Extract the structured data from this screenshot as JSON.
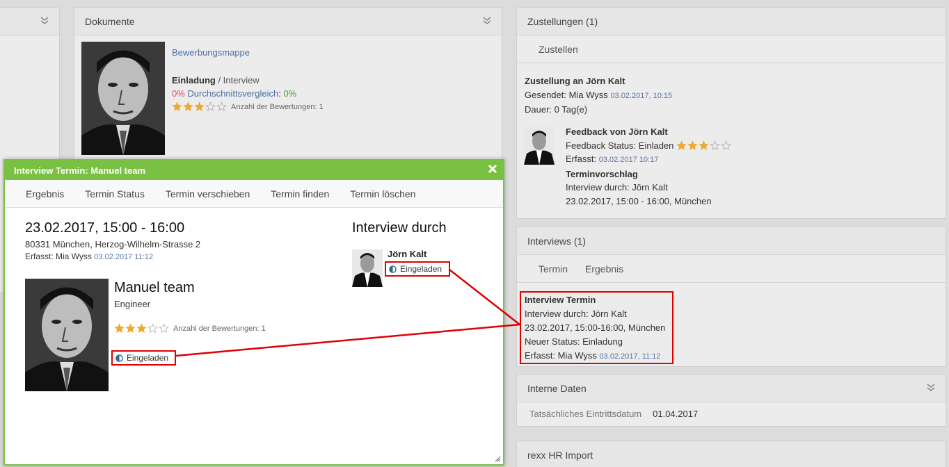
{
  "left_panel": {
    "chevron": "chevron-down-double-icon"
  },
  "documents": {
    "title": "Dokumente",
    "link": "Bewerbungsmappe",
    "invitation_bold": "Einladung",
    "invitation_rest": " / Interview",
    "percent": "0%",
    "avg_label": "Durchschnittsvergleich",
    "avg_value": "0%",
    "rating_label": "Anzahl der Bewertungen: 1",
    "rating": 3
  },
  "deliveries": {
    "title": "Zustellungen (1)",
    "tab": "Zustellen",
    "delivery_title": "Zustellung an Jörn Kalt",
    "sent_label": "Gesendet: Mia Wyss",
    "sent_date": "03.02.2017, 10:15",
    "duration": "Dauer: 0 Tag(e)",
    "feedback_title": "Feedback von Jörn Kalt",
    "feedback_status": "Feedback Status: Einladen",
    "feedback_rating": 3,
    "captured_label": "Erfasst:",
    "captured_date": "03.02.2017 10:17",
    "proposal_title": "Terminvorschlag",
    "proposal_by": "Interview durch: Jörn Kalt",
    "proposal_when": "23.02.2017, 15:00 - 16:00, München"
  },
  "interviews": {
    "title": "Interviews (1)",
    "tabs": [
      "Termin",
      "Ergebnis"
    ],
    "box_title": "Interview Termin",
    "by": "Interview durch: Jörn Kalt",
    "when": "23.02.2017, 15:00-16:00, München",
    "new_status": "Neuer Status: Einladung",
    "captured_label": "Erfasst: Mia Wyss",
    "captured_date": "03.02.2017, 11:12"
  },
  "internal": {
    "title": "Interne Daten",
    "field_label": "Tatsächliches Eintrittsdatum",
    "field_value": "01.04.2017"
  },
  "rexx": {
    "title": "rexx HR Import"
  },
  "modal": {
    "title": "Interview Termin: Manuel team",
    "tabs": [
      "Ergebnis",
      "Termin Status",
      "Termin verschieben",
      "Termin finden",
      "Termin löschen"
    ],
    "datetime": "23.02.2017, 15:00 - 16:00",
    "address": "80331 München, Herzog-Wilhelm-Strasse 2",
    "captured_label": "Erfasst: Mia Wyss",
    "captured_date": "03.02.2017 11:12",
    "candidate_name": "Manuel team",
    "candidate_role": "Engineer",
    "rating": 3,
    "rating_label": "Anzahl der Bewertungen: 1",
    "candidate_status": "Eingeladen",
    "interviewer_heading": "Interview durch",
    "interviewer_name": "Jörn Kalt",
    "interviewer_status": "Eingeladen"
  },
  "colors": {
    "accent_green": "#7ac143",
    "highlight_red": "#e00000",
    "star_gold": "#f0a830",
    "link_blue": "#4a6fa5"
  }
}
